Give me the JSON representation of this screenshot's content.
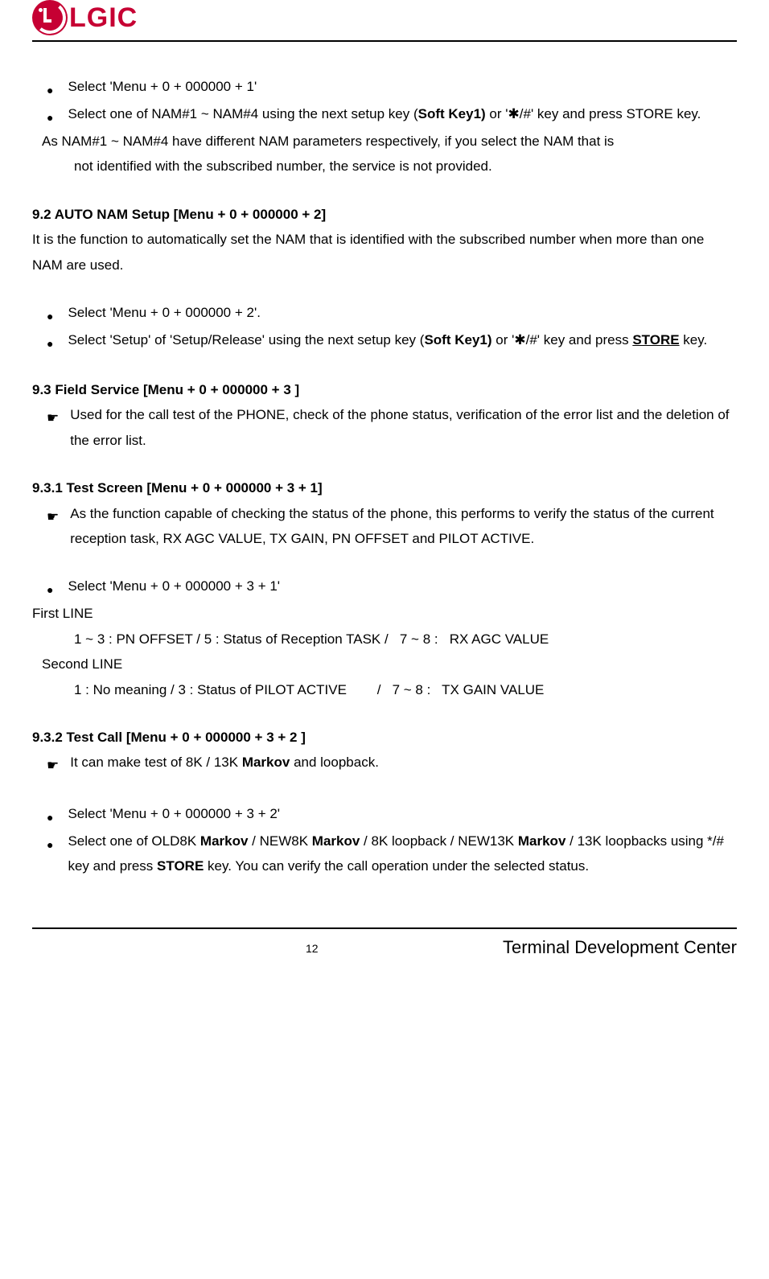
{
  "header": {
    "brand": "LGIC"
  },
  "content": {
    "b1": "Select 'Menu + 0 + 000000 + 1'",
    "b2_pre": "Select one of NAM#1 ~ NAM#4 using the next setup key (",
    "b2_sk": "Soft Key1)",
    "b2_mid": " or '",
    "b2_star": "✱",
    "b2_post": "/#' key and press STORE key.",
    "note1": "As NAM#1 ~ NAM#4 have different NAM parameters respectively, if you select the NAM that is",
    "note1b": "not identified with the subscribed number, the service is not provided.",
    "h92": "9.2 AUTO NAM Setup [Menu + 0 + 000000 + 2]",
    "p92a": "It is the function to automatically set the NAM that is identified with the subscribed number when more than one NAM are used.",
    "b3": "Select 'Menu + 0 + 000000 + 2'.",
    "b4_pre": "Select 'Setup' of 'Setup/Release' using the next setup key (",
    "b4_sk": "Soft Key1)",
    "b4_mid": " or '",
    "b4_star": "✱",
    "b4_post": "/#' key and press ",
    "b4_store": "STORE",
    "b4_end": " key.",
    "h93": "9.3 Field Service [Menu + 0 + 000000 + 3 ]",
    "p93": "Used for the call test of the PHONE, check of the phone status, verification of the error list and the deletion of the error list.",
    "h931": "9.3.1 Test Screen [Menu + 0 + 000000 + 3 + 1]",
    "p931": "As the function capable of checking the status of the phone, this performs to verify the status of the current reception task, RX AGC VALUE, TX GAIN, PN OFFSET and PILOT ACTIVE.",
    "b5": "Select 'Menu + 0 + 000000 + 3 + 1'",
    "fl": "First LINE",
    "fl1": "1 ~ 3 : PN OFFSET / 5 : Status of Reception TASK /   7 ~ 8 :   RX AGC VALUE",
    "sl": "Second LINE",
    "sl1": "1 : No meaning / 3 : Status of PILOT ACTIVE        /   7 ~ 8 :   TX GAIN VALUE",
    "h932": "9.3.2 Test Call [Menu + 0 + 000000 + 3 + 2 ]",
    "p932_pre": "It can make test of 8K / 13K ",
    "p932_m": "Markov",
    "p932_post": " and loopback.",
    "b6": "Select 'Menu + 0 + 000000 + 3 + 2'",
    "b7_1": "Select one of OLD8K ",
    "b7_m1": "Markov",
    "b7_2": " / NEW8K ",
    "b7_m2": "Markov",
    "b7_3": " / 8K loopback / NEW13K ",
    "b7_m3": "Markov",
    "b7_4": " / 13K loopbacks using */# key and press ",
    "b7_store": "STORE",
    "b7_5": " key. You can verify the call operation under the selected status."
  },
  "footer": {
    "page": "12",
    "text": "Terminal Development Center"
  }
}
